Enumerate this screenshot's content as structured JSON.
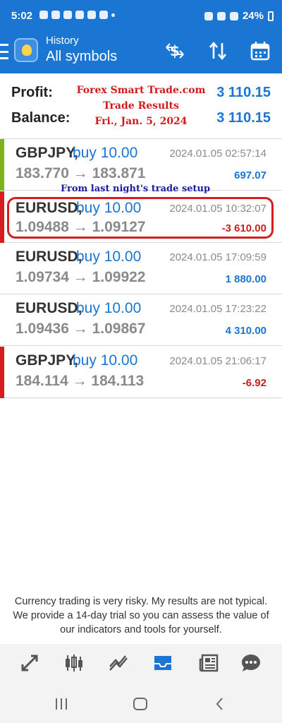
{
  "status_bar": {
    "time": "5:02",
    "battery": "24%"
  },
  "app_bar": {
    "subtitle": "History",
    "title": "All symbols"
  },
  "summary": {
    "profit_label": "Profit:",
    "profit_value": "3 110.15",
    "balance_label": "Balance:",
    "balance_value": "3 110.15"
  },
  "promo": {
    "line1": "Forex Smart Trade.com",
    "line2": "Trade Results",
    "line3": "Fri., Jan. 5, 2024"
  },
  "setup_note": "From last night's trade setup",
  "trades": [
    {
      "symbol": "GBPJPY,",
      "side": "buy 10.00",
      "time": "2024.01.05 02:57:14",
      "prices": "183.770 → 183.871",
      "profit": "697.07",
      "accent": "#7fb31a"
    },
    {
      "symbol": "EURUSD,",
      "side": "buy 10.00",
      "time": "2024.01.05 10:32:07",
      "prices": "1.09488 → 1.09127",
      "profit": "-3 610.00",
      "accent": "#d71d1d"
    },
    {
      "symbol": "EURUSD,",
      "side": "buy 10.00",
      "time": "2024.01.05 17:09:59",
      "prices": "1.09734 → 1.09922",
      "profit": "1 880.00",
      "accent": ""
    },
    {
      "symbol": "EURUSD,",
      "side": "buy 10.00",
      "time": "2024.01.05 17:23:22",
      "prices": "1.09436 → 1.09867",
      "profit": "4 310.00",
      "accent": ""
    },
    {
      "symbol": "GBPJPY,",
      "side": "buy 10.00",
      "time": "2024.01.05 21:06:17",
      "prices": "184.114 → 184.113",
      "profit": "-6.92",
      "accent": "#d71d1d"
    }
  ],
  "disclaimer": "Currency trading is very risky. My results are not typical. We provide a 14-day trial so you can assess the value of our indicators and tools for yourself.",
  "colors": {
    "primary": "#1a76d2",
    "loss": "#c6201f",
    "win_accent": "#7fb31a"
  },
  "icons": {
    "top": [
      "currency-exchange-icon",
      "sort-icon",
      "calendar-icon"
    ],
    "bottom_nav": [
      "quotes-icon",
      "chart-icon",
      "trade-icon",
      "history-icon",
      "news-icon",
      "chat-icon"
    ]
  }
}
